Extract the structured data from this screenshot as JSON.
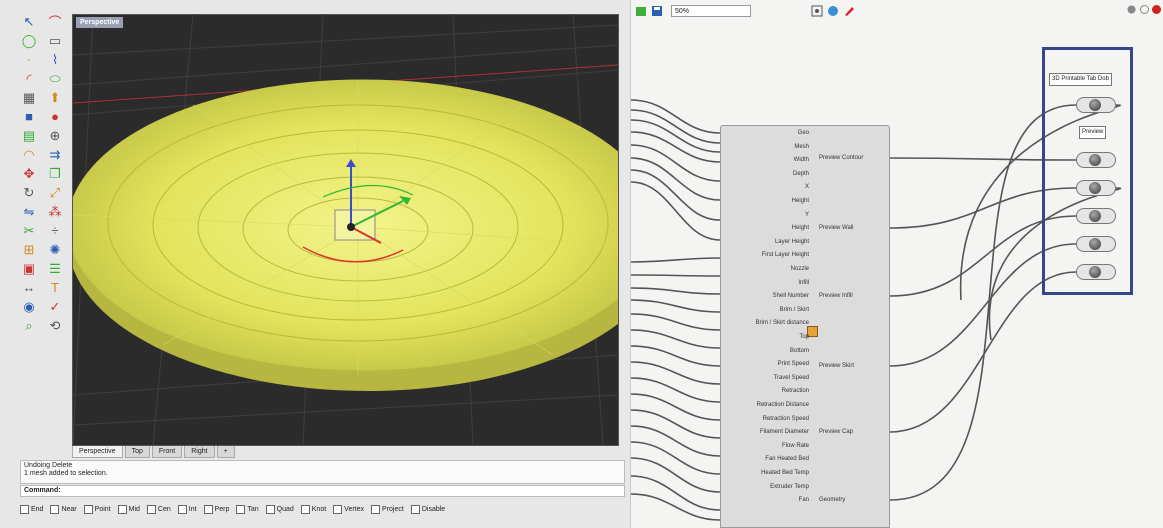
{
  "rhino": {
    "viewport_title": "Perspective",
    "viewport_tabs": [
      "Perspective",
      "Top",
      "Front",
      "Right",
      "+"
    ],
    "command_history": [
      "Undoing Delete",
      "1 mesh added to selection."
    ],
    "command_prompt": "Command:",
    "snaps": [
      "End",
      "Near",
      "Point",
      "Mid",
      "Cen",
      "Int",
      "Perp",
      "Tan",
      "Quad",
      "Knot",
      "Vertex",
      "Project",
      "Disable"
    ],
    "toolbar_icons": [
      "select-icon",
      "curve-icon",
      "circle-icon",
      "rectangle-icon",
      "point-icon",
      "polyline-icon",
      "arc-icon",
      "ellipse-icon",
      "surface-icon",
      "extrude-icon",
      "solid-icon",
      "sphere-icon",
      "mesh-icon",
      "boolean-icon",
      "fillet-icon",
      "offset-icon",
      "move-icon",
      "copy-icon",
      "rotate-icon",
      "scale-icon",
      "mirror-icon",
      "array-icon",
      "trim-icon",
      "split-icon",
      "join-icon",
      "explode-icon",
      "group-icon",
      "layer-icon",
      "dimension-icon",
      "text-icon",
      "render-icon",
      "check-icon",
      "analyze-icon",
      "transform-icon"
    ]
  },
  "grasshopper": {
    "zoom": "50%",
    "component_inputs": [
      "Geo",
      "Mesh",
      "Width",
      "Depth",
      "X",
      "Height",
      "Y",
      "Height",
      "Layer Height",
      "First Layer Height",
      "Nozzle",
      "Infill",
      "Shell Number",
      "Brim / Skirt",
      "Brim / Skirt distance",
      "Top",
      "Bottom",
      "Print Speed",
      "Travel Speed",
      "Retraction",
      "Retraction Distance",
      "Retraction Speed",
      "Filament Diameter",
      "Flow Rate",
      "Fan Heated Bed",
      "Heated Bed Temp",
      "Extruder Temp",
      "Fan"
    ],
    "component_outputs": [
      "Preview Contour",
      "Preview Wall",
      "Preview Infill",
      "Preview Skirt",
      "Preview Cap",
      "Geometry"
    ],
    "panel_labels": [
      "3D Printable Tab Dob",
      "Preview"
    ],
    "accent_color": "#35468a",
    "component_core_color": "#e8a23a"
  }
}
